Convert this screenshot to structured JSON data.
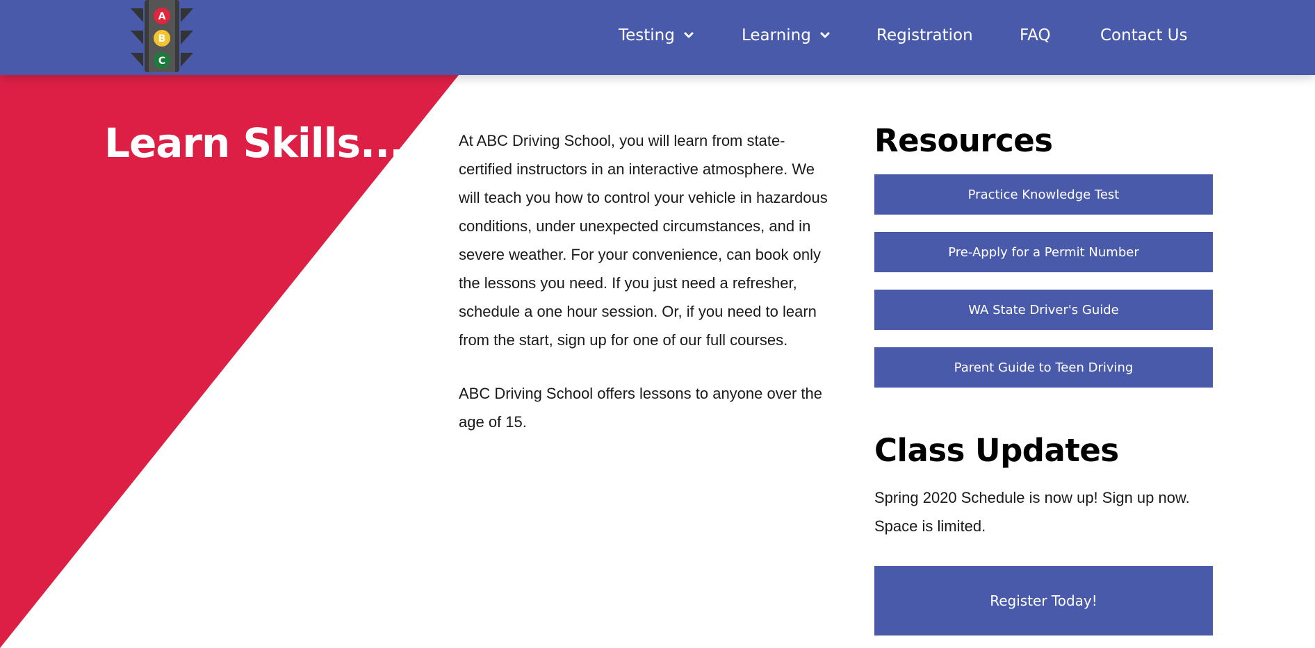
{
  "header": {
    "logo": {
      "icon": "traffic-light-logo",
      "lights": [
        "A",
        "B",
        "C"
      ],
      "colors": [
        "#e0253d",
        "#f4c430",
        "#1e7a3c"
      ]
    },
    "nav": [
      {
        "label": "Testing",
        "has_dropdown": true
      },
      {
        "label": "Learning",
        "has_dropdown": true
      },
      {
        "label": "Registration",
        "has_dropdown": false
      },
      {
        "label": "FAQ",
        "has_dropdown": false
      },
      {
        "label": "Contact Us",
        "has_dropdown": false
      }
    ]
  },
  "hero": {
    "title": "Learn Skills..."
  },
  "main": {
    "paragraphs": [
      "At ABC Driving School, you will learn from state-certified instructors in an interactive atmosphere. We will teach you how to control your vehicle in hazardous conditions, under unexpected circumstances, and in severe weather. For your convenience, can book only the lessons you need. If you just need a refresher, schedule a one hour session. Or, if you need to learn from the start, sign up for one of our full courses.",
      "ABC Driving School offers lessons to anyone over the age of 15."
    ]
  },
  "resources": {
    "heading": "Resources",
    "buttons": [
      "Practice Knowledge Test",
      "Pre-Apply for a Permit Number",
      "WA State Driver's Guide",
      "Parent Guide to Teen Driving"
    ]
  },
  "class_updates": {
    "heading": "Class Updates",
    "text": "Spring 2020 Schedule is now up! Sign up now. Space is limited.",
    "register_label": "Register Today!"
  },
  "colors": {
    "primary": "#4a5aab",
    "accent": "#dd1f45",
    "text": "#1a1a1a"
  }
}
